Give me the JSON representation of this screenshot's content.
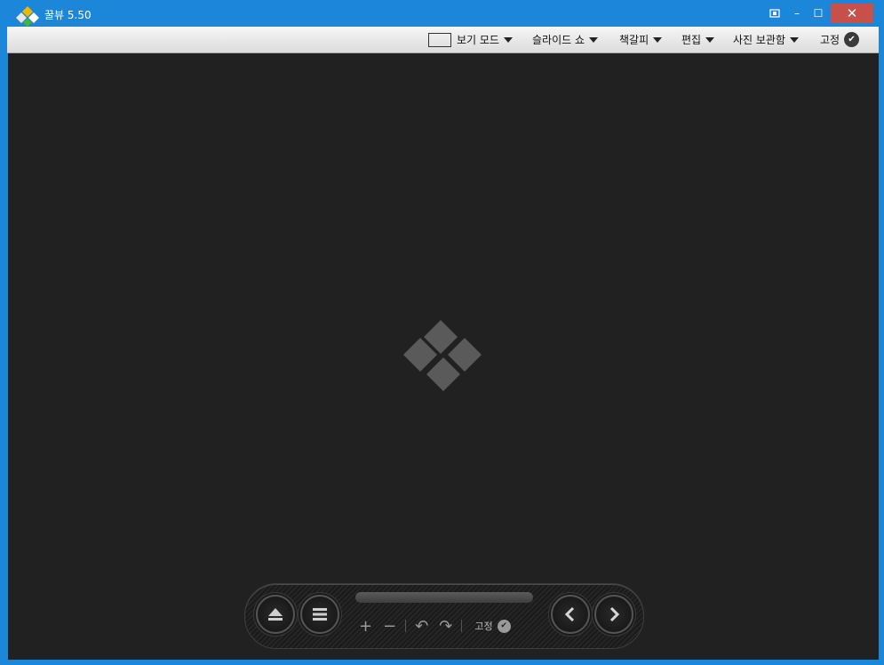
{
  "window": {
    "title": "꿀뷰 5.50",
    "controls": {
      "minimize": "–",
      "maximize": "☐",
      "close": "✕"
    }
  },
  "menu": {
    "view_mode": "보기 모드",
    "slideshow": "슬라이드 쇼",
    "bookmark": "책갈피",
    "edit": "편집",
    "photo_storage": "사진 보관함",
    "pin": "고정"
  },
  "toolbar": {
    "zoom_in": "+",
    "zoom_out": "−",
    "rotate_left": "↶",
    "rotate_right": "↷",
    "pin": "고정",
    "progress": 0
  },
  "colors": {
    "titlebar": "#1c87d9",
    "viewer_bg": "#212121",
    "close_button": "#c7504a"
  },
  "icons": [
    "app-logo-icon",
    "screen-icon",
    "view-mode-icon",
    "pin-check-icon",
    "eject-icon",
    "list-icon",
    "prev-icon",
    "next-icon"
  ]
}
